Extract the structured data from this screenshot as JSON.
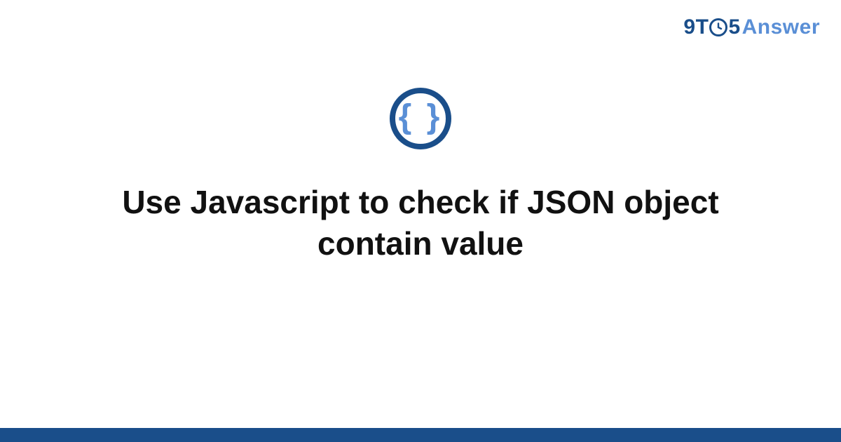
{
  "brand": {
    "nine": "9",
    "t": "T",
    "five": "5",
    "answer": "Answer"
  },
  "badge": {
    "glyph": "{ }"
  },
  "title": "Use Javascript to check if JSON object contain value",
  "colors": {
    "primary": "#1a4e8a",
    "accent": "#5a8fd6",
    "text": "#111111",
    "bg": "#ffffff"
  }
}
